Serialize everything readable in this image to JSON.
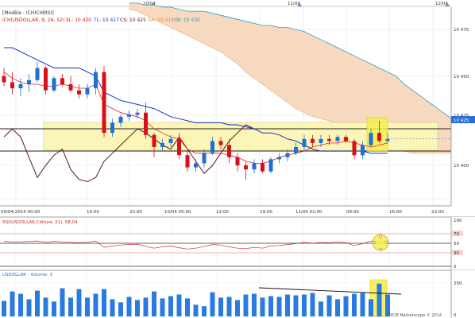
{
  "top_dates": [
    "10/04",
    "11/04",
    "12/04"
  ],
  "model_label": "[Modèle : ICHICHIRSI]",
  "indicator_line": {
    "name": "ICH(USDOLLAR, 9, 26, 52)",
    "sl": "SL: 10 420",
    "tl": "TL: 10 417",
    "cs": "CS: 10 425",
    "sa": "SA: 10 418",
    "sb": "SB: 10 430"
  },
  "price_axis": [
    "10 475",
    "10 450",
    "10 425",
    "10 400"
  ],
  "current_price": "10 425",
  "time_axis": [
    "09/04/2014 00:00",
    "15:00",
    "22:00",
    "10/04 05:00",
    "12:00",
    "19:00",
    "11/04 02:00",
    "09:00",
    "16:00",
    "23:00"
  ],
  "rsi_label": "RSI(USDOLLAR,Clôture, 21), 58,04",
  "rsi_axis": [
    "100",
    "70",
    "50",
    "30",
    "0"
  ],
  "volume_label": "USDOLLAR - Volume: 3",
  "volume_axis": [
    "250",
    "0"
  ],
  "copyright": "FXCM Marketscope © 2014",
  "colors": {
    "bull": "#1f6fd6",
    "bear": "#d8101a",
    "tenkan": "#e02020",
    "kijun": "#1530c8",
    "chikou": "#5a1030",
    "cloud": "#f7d9bf",
    "cloud_edge": "#f0b890",
    "senkou_b": "#2aa0c8",
    "zone": "#fbf6b8",
    "volume": "#2a7be0"
  },
  "chart_data": {
    "type": "candlestick",
    "price_ylim": [
      10392,
      10490
    ],
    "n_bars": 47,
    "ohlc": [
      {
        "o": 10456,
        "h": 10460,
        "l": 10451,
        "c": 10453
      },
      {
        "o": 10453,
        "h": 10458,
        "l": 10447,
        "c": 10450
      },
      {
        "o": 10450,
        "h": 10455,
        "l": 10446,
        "c": 10452
      },
      {
        "o": 10452,
        "h": 10457,
        "l": 10448,
        "c": 10454
      },
      {
        "o": 10454,
        "h": 10463,
        "l": 10453,
        "c": 10460
      },
      {
        "o": 10460,
        "h": 10461,
        "l": 10447,
        "c": 10449
      },
      {
        "o": 10449,
        "h": 10456,
        "l": 10448,
        "c": 10455
      },
      {
        "o": 10455,
        "h": 10457,
        "l": 10451,
        "c": 10452
      },
      {
        "o": 10452,
        "h": 10456,
        "l": 10448,
        "c": 10449
      },
      {
        "o": 10449,
        "h": 10452,
        "l": 10445,
        "c": 10447
      },
      {
        "o": 10447,
        "h": 10452,
        "l": 10445,
        "c": 10450
      },
      {
        "o": 10450,
        "h": 10460,
        "l": 10447,
        "c": 10458
      },
      {
        "o": 10458,
        "h": 10461,
        "l": 10426,
        "c": 10428
      },
      {
        "o": 10428,
        "h": 10435,
        "l": 10426,
        "c": 10433
      },
      {
        "o": 10433,
        "h": 10437,
        "l": 10431,
        "c": 10436
      },
      {
        "o": 10436,
        "h": 10439,
        "l": 10434,
        "c": 10437
      },
      {
        "o": 10437,
        "h": 10440,
        "l": 10435,
        "c": 10438
      },
      {
        "o": 10438,
        "h": 10443,
        "l": 10425,
        "c": 10427
      },
      {
        "o": 10427,
        "h": 10428,
        "l": 10416,
        "c": 10421
      },
      {
        "o": 10421,
        "h": 10425,
        "l": 10419,
        "c": 10423
      },
      {
        "o": 10423,
        "h": 10427,
        "l": 10421,
        "c": 10425
      },
      {
        "o": 10425,
        "h": 10428,
        "l": 10415,
        "c": 10417
      },
      {
        "o": 10417,
        "h": 10419,
        "l": 10409,
        "c": 10411
      },
      {
        "o": 10411,
        "h": 10415,
        "l": 10409,
        "c": 10413
      },
      {
        "o": 10413,
        "h": 10420,
        "l": 10411,
        "c": 10418
      },
      {
        "o": 10418,
        "h": 10426,
        "l": 10417,
        "c": 10424
      },
      {
        "o": 10424,
        "h": 10426,
        "l": 10420,
        "c": 10422
      },
      {
        "o": 10422,
        "h": 10425,
        "l": 10413,
        "c": 10416
      },
      {
        "o": 10416,
        "h": 10418,
        "l": 10409,
        "c": 10412
      },
      {
        "o": 10412,
        "h": 10414,
        "l": 10405,
        "c": 10410
      },
      {
        "o": 10410,
        "h": 10415,
        "l": 10408,
        "c": 10413
      },
      {
        "o": 10413,
        "h": 10415,
        "l": 10408,
        "c": 10409
      },
      {
        "o": 10409,
        "h": 10416,
        "l": 10408,
        "c": 10415
      },
      {
        "o": 10415,
        "h": 10418,
        "l": 10413,
        "c": 10416
      },
      {
        "o": 10416,
        "h": 10420,
        "l": 10414,
        "c": 10418
      },
      {
        "o": 10418,
        "h": 10423,
        "l": 10417,
        "c": 10421
      },
      {
        "o": 10421,
        "h": 10427,
        "l": 10419,
        "c": 10425
      },
      {
        "o": 10425,
        "h": 10427,
        "l": 10421,
        "c": 10423
      },
      {
        "o": 10423,
        "h": 10427,
        "l": 10421,
        "c": 10425
      },
      {
        "o": 10425,
        "h": 10427,
        "l": 10422,
        "c": 10424
      },
      {
        "o": 10424,
        "h": 10427,
        "l": 10422,
        "c": 10426
      },
      {
        "o": 10426,
        "h": 10427,
        "l": 10423,
        "c": 10424
      },
      {
        "o": 10424,
        "h": 10425,
        "l": 10415,
        "c": 10417
      },
      {
        "o": 10417,
        "h": 10424,
        "l": 10415,
        "c": 10422
      },
      {
        "o": 10422,
        "h": 10430,
        "l": 10421,
        "c": 10428
      },
      {
        "o": 10428,
        "h": 10434,
        "l": 10423,
        "c": 10424
      },
      {
        "o": 10424,
        "h": 10428,
        "l": 10423,
        "c": 10425
      }
    ],
    "tenkan": [
      10458,
      10455,
      10453,
      10452,
      10452,
      10451,
      10451,
      10452,
      10451,
      10450,
      10450,
      10452,
      10442,
      10440,
      10438,
      10437,
      10436,
      10434,
      10430,
      10428,
      10426,
      10425,
      10420,
      10418,
      10418,
      10418,
      10418,
      10417,
      10416,
      10414,
      10413,
      10413,
      10414,
      10416,
      10417,
      10418,
      10419,
      10421,
      10422,
      10423,
      10423,
      10424,
      10423,
      10422,
      10421,
      10422,
      10423
    ],
    "kijun": [
      10470,
      10470,
      10468,
      10466,
      10464,
      10462,
      10460,
      10460,
      10460,
      10460,
      10458,
      10456,
      10448,
      10446,
      10444,
      10443,
      10442,
      10441,
      10440,
      10438,
      10436,
      10435,
      10434,
      10433,
      10433,
      10433,
      10433,
      10432,
      10432,
      10431,
      10430,
      10428,
      10428,
      10427,
      10425,
      10424,
      10422,
      10420,
      10419,
      10419,
      10419,
      10419,
      10419,
      10419,
      10418,
      10418,
      10418
    ],
    "chikou": [
      10426,
      10430,
      10426,
      10416,
      10406,
      10412,
      10417,
      10420,
      10410,
      10405,
      10404,
      10406,
      10414,
      10418,
      10422,
      10426,
      10430,
      10428,
      10425,
      10422,
      10420,
      10426,
      10420,
      10414,
      10408,
      10412,
      10418,
      10424,
      10428,
      10432,
      10430
    ],
    "senkou_a": [
      10489,
      10488,
      10486,
      10484,
      10482,
      10480,
      10478,
      10476,
      10474,
      10472,
      10470,
      10468,
      10465,
      10462,
      10458,
      10455,
      10452,
      10449,
      10446,
      10443,
      10440,
      10438,
      10436,
      10435,
      10434,
      10432,
      10430,
      10428,
      10426,
      10424,
      10422,
      10421,
      10420,
      10419,
      10418,
      10418,
      10418,
      10418,
      10418,
      10418,
      10418,
      10418,
      10418,
      10418,
      10418,
      10418,
      10418,
      10418,
      10418,
      10418,
      10418,
      10418
    ],
    "senkou_b": [
      10492,
      10492,
      10491,
      10491,
      10490,
      10490,
      10489,
      10488,
      10488,
      10488,
      10487,
      10486,
      10485,
      10484,
      10483,
      10482,
      10481,
      10481,
      10480,
      10480,
      10479,
      10478,
      10476,
      10474,
      10472,
      10470,
      10468,
      10466,
      10464,
      10462,
      10460,
      10458,
      10456,
      10452,
      10449,
      10446,
      10443,
      10440,
      10437,
      10434,
      10432,
      10431,
      10430,
      10430,
      10430,
      10430,
      10430,
      10430,
      10430,
      10430,
      10430,
      10430
    ],
    "rsi": [
      55,
      54,
      54,
      55,
      56,
      53,
      55,
      54,
      53,
      52,
      53,
      56,
      42,
      45,
      47,
      48,
      49,
      44,
      40,
      43,
      45,
      41,
      38,
      40,
      44,
      48,
      47,
      43,
      40,
      39,
      42,
      40,
      45,
      46,
      48,
      50,
      53,
      51,
      53,
      52,
      54,
      52,
      46,
      50,
      56,
      53,
      58
    ],
    "rsi_levels": [
      70,
      50,
      30
    ],
    "rsi_ylim": [
      0,
      100
    ],
    "volume": [
      100,
      160,
      145,
      110,
      165,
      120,
      95,
      180,
      120,
      175,
      120,
      145,
      175,
      110,
      90,
      125,
      105,
      120,
      160,
      115,
      130,
      140,
      115,
      75,
      65,
      155,
      120,
      125,
      105,
      140,
      145,
      120,
      130,
      125,
      140,
      135,
      140,
      150,
      95,
      135,
      110,
      130,
      145,
      150,
      110,
      210,
      140
    ],
    "volume_ylim": [
      0,
      280
    ]
  }
}
